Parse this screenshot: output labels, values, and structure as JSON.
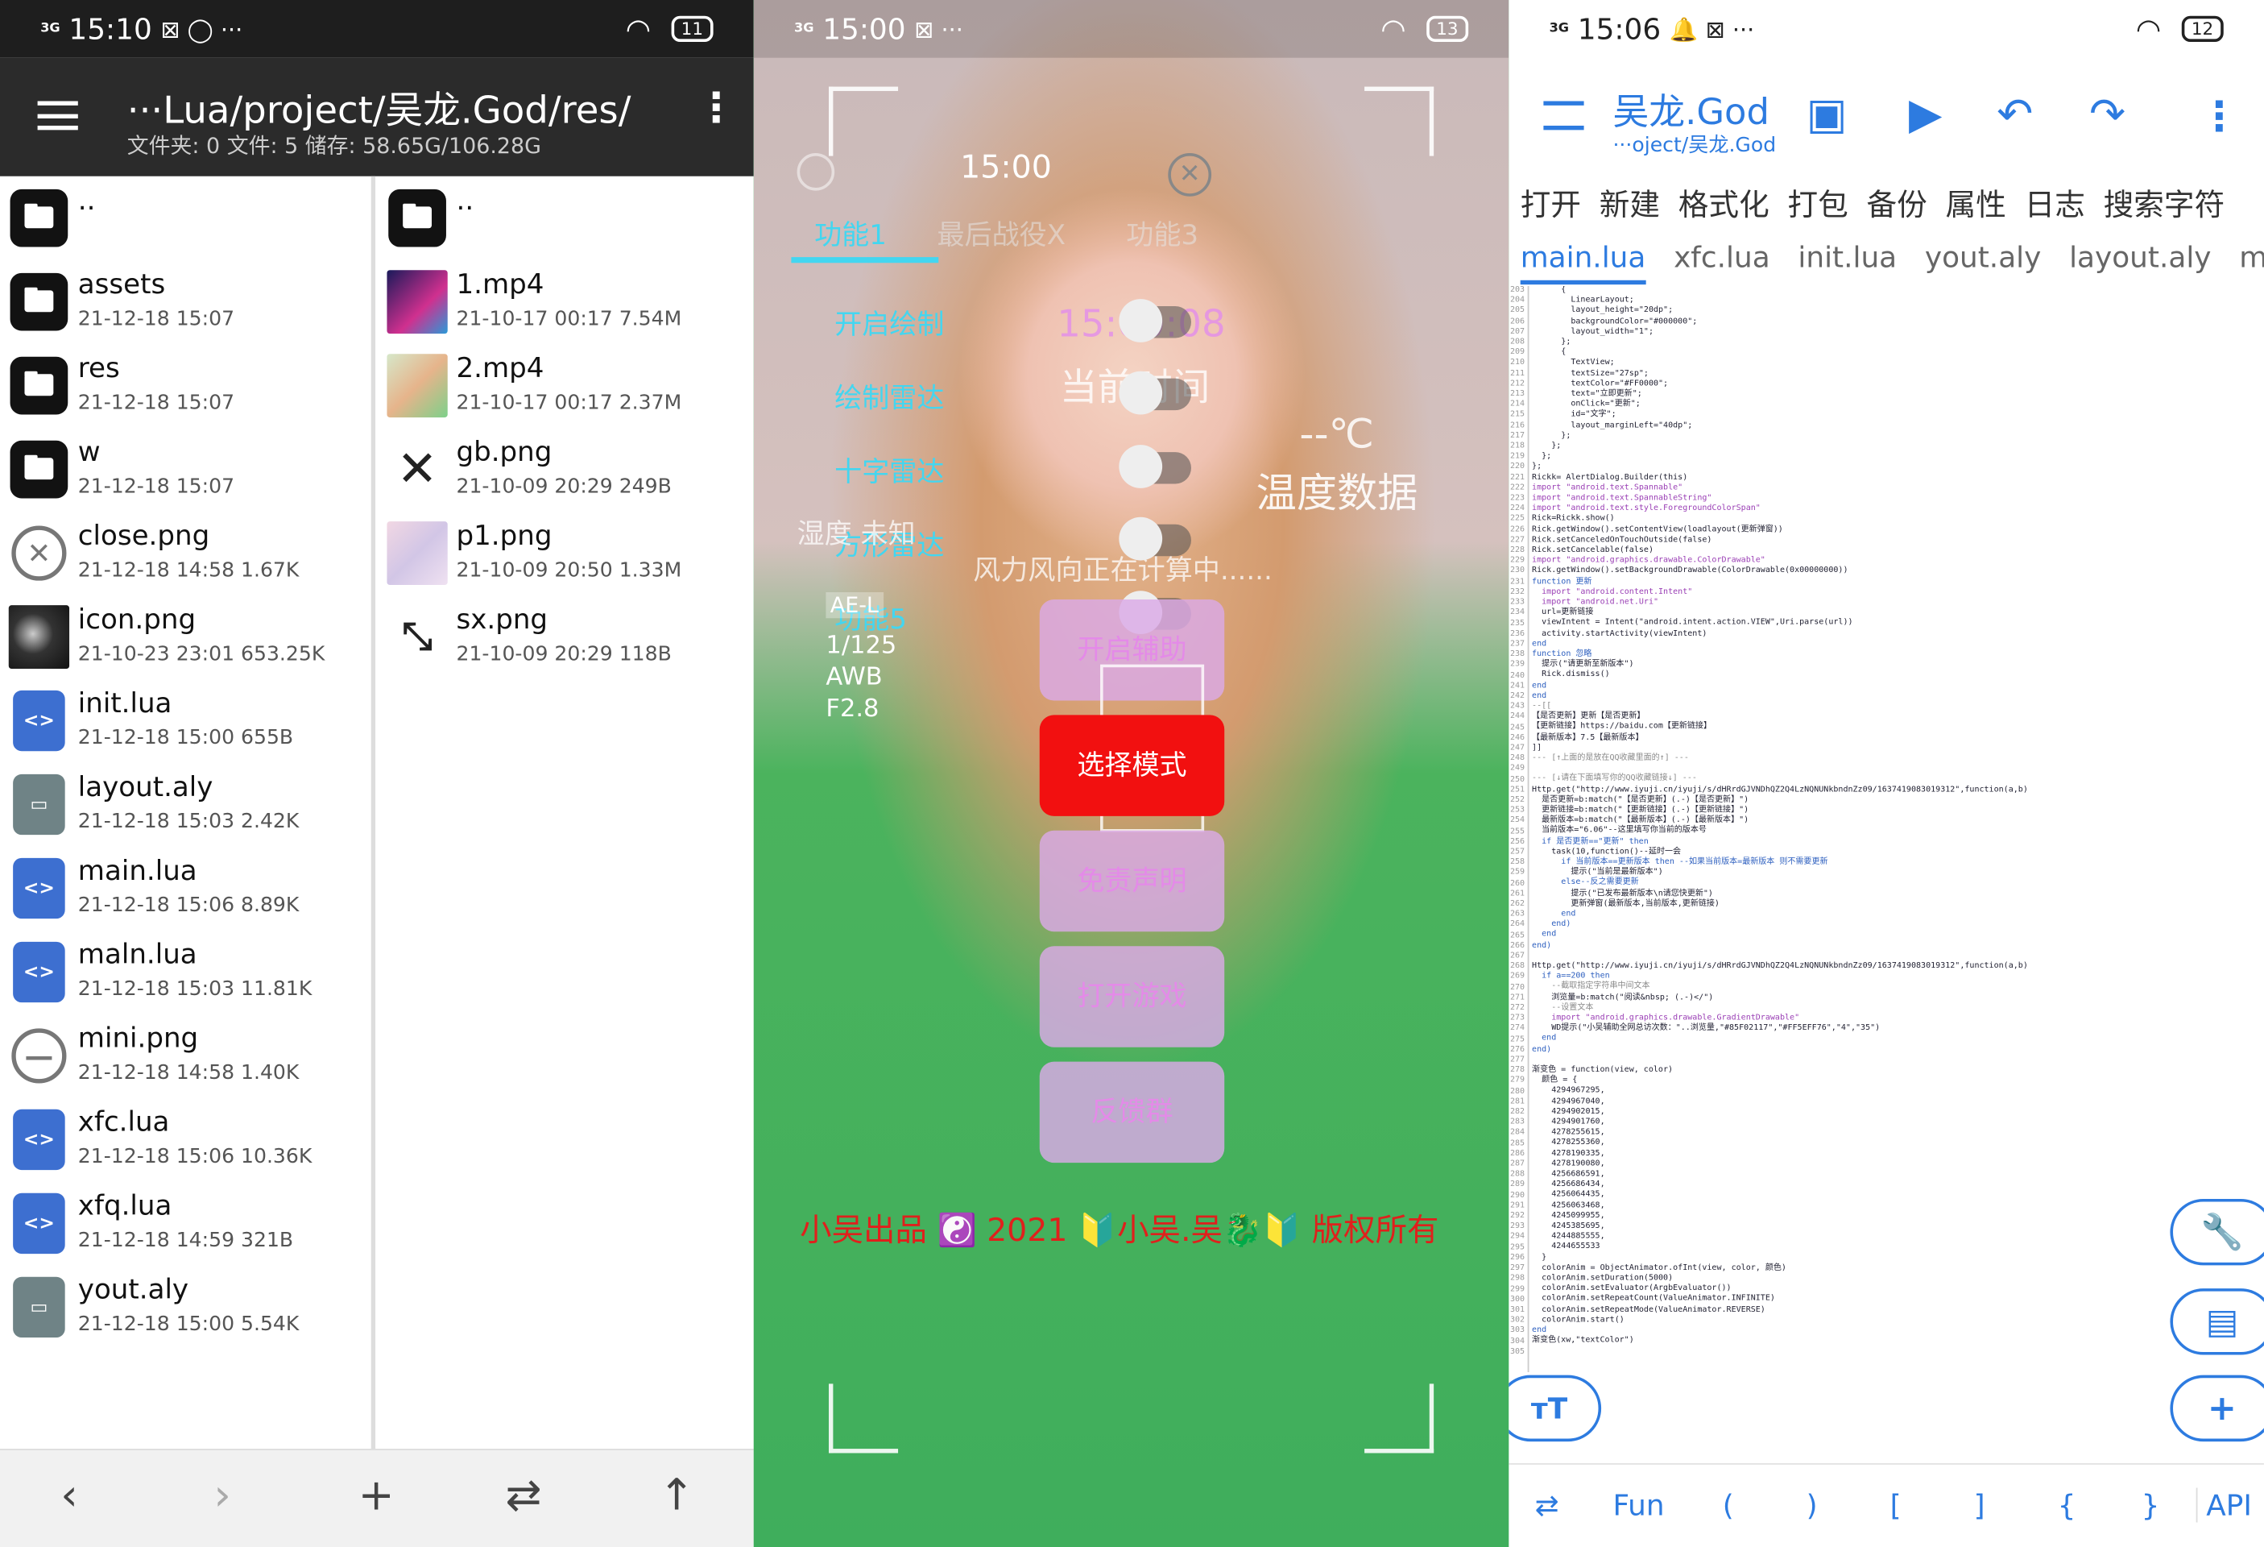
{
  "panel1": {
    "status": {
      "signal": "3G",
      "time": "15:10",
      "icons": "⊠ ◯ ···",
      "battery": "11"
    },
    "toolbar": {
      "path": "···Lua/project/吴龙.God/res/",
      "info": "文件夹: 0  文件: 5  储存: 58.65G/106.28G"
    },
    "left_list": [
      {
        "name": "..",
        "meta": "",
        "icon": "folder-icon"
      },
      {
        "name": "assets",
        "meta": "21-12-18 15:07",
        "icon": "folder-icon"
      },
      {
        "name": "res",
        "meta": "21-12-18 15:07",
        "icon": "folder-icon"
      },
      {
        "name": "w",
        "meta": "21-12-18 15:07",
        "icon": "folder-icon"
      },
      {
        "name": "close.png",
        "meta": "21-12-18 14:58  1.67K",
        "icon": "close-circle-icon"
      },
      {
        "name": "icon.png",
        "meta": "21-10-23 23:01  653.25K",
        "icon": "image-thumbnail"
      },
      {
        "name": "init.lua",
        "meta": "21-12-18 15:00  655B",
        "icon": "code-file-icon"
      },
      {
        "name": "layout.aly",
        "meta": "21-12-18 15:03  2.42K",
        "icon": "file-icon"
      },
      {
        "name": "main.lua",
        "meta": "21-12-18 15:06  8.89K",
        "icon": "code-file-icon"
      },
      {
        "name": "maln.lua",
        "meta": "21-12-18 15:03  11.81K",
        "icon": "code-file-icon"
      },
      {
        "name": "mini.png",
        "meta": "21-12-18 14:58  1.40K",
        "icon": "minus-circle-icon"
      },
      {
        "name": "xfc.lua",
        "meta": "21-12-18 15:06  10.36K",
        "icon": "code-file-icon"
      },
      {
        "name": "xfq.lua",
        "meta": "21-12-18 14:59  321B",
        "icon": "code-file-icon"
      },
      {
        "name": "yout.aly",
        "meta": "21-12-18 15:00  5.54K",
        "icon": "file-icon"
      }
    ],
    "right_list": [
      {
        "name": "..",
        "meta": "",
        "icon": "folder-icon"
      },
      {
        "name": "1.mp4",
        "meta": "21-10-17 00:17  7.54M",
        "icon": "video-thumbnail"
      },
      {
        "name": "2.mp4",
        "meta": "21-10-17 00:17  2.37M",
        "icon": "video-thumbnail"
      },
      {
        "name": "gb.png",
        "meta": "21-10-09 20:29  249B",
        "icon": "x-icon"
      },
      {
        "name": "p1.png",
        "meta": "21-10-09 20:50  1.33M",
        "icon": "image-thumbnail"
      },
      {
        "name": "sx.png",
        "meta": "21-10-09 20:29  118B",
        "icon": "shrink-icon"
      }
    ],
    "bottom_nav": {
      "back": "‹",
      "forward": "›",
      "add": "+",
      "swap": "⇄",
      "up": "↑"
    }
  },
  "panel2": {
    "status": {
      "signal": "3G",
      "time": "15:00",
      "icons": "⊠ ···",
      "battery": "13"
    },
    "clock": "15:00",
    "tabs": [
      "功能1",
      "最后战役X",
      "功能3"
    ],
    "left_menu": [
      "开启绘制",
      "绘制雷达",
      "十字雷达",
      "方形雷达",
      "功能5"
    ],
    "time_value": "15:00:08",
    "time_label": "当前时间",
    "temp_value": "--℃",
    "temp_label": "温度数据",
    "humidity_label": "湿度 未知",
    "wind_text": "风力风向正在计算中......",
    "camera_info": [
      "AE-L",
      "1/125",
      "AWB",
      "F2.8"
    ],
    "buttons": [
      "开启辅助",
      "选择模式",
      "免责声明",
      "打开游戏",
      "反馈群"
    ],
    "copyright": "小吴出品 ☯️ 2021 🔰小吴.吴🐉🔰 版权所有",
    "colors": {
      "accent": "#43d6f0",
      "select": "#f21010",
      "copyright": "#e0201c"
    }
  },
  "panel3": {
    "status": {
      "signal": "3G",
      "time": "15:06",
      "icons": "🔔 ⊠ ···",
      "battery": "12"
    },
    "title": "吴龙.God",
    "subtitle": "···oject/吴龙.God",
    "menu": [
      "打开",
      "新建",
      "格式化",
      "打包",
      "备份",
      "属性",
      "日志",
      "搜索字符"
    ],
    "tabs": [
      "main.lua",
      "xfc.lua",
      "init.lua",
      "yout.aly",
      "layout.aly",
      "maln.lua"
    ],
    "active_tab": "main.lua",
    "code_lines": [
      "      {",
      "        LinearLayout;",
      "        layout_height=\"20dp\";",
      "        backgroundColor=\"#000000\";",
      "        layout_width=\"1\";",
      "      };",
      "      {",
      "        TextView;",
      "        textSize=\"27sp\";",
      "        textColor=\"#FF0000\";",
      "        text=\"立即更新\";",
      "        onClick=\"更新\";",
      "        id=\"文字\";",
      "        layout_marginLeft=\"40dp\";",
      "      };",
      "    };",
      "  };",
      "};",
      "Rickk= AlertDialog.Builder(this)",
      "import \"android.text.Spannable\"",
      "import \"android.text.SpannableString\"",
      "import \"android.text.style.ForegroundColorSpan\"",
      "Rick=Rickk.show()",
      "Rick.getWindow().setContentView(loadlayout(更新弹窗))",
      "Rick.setCanceledOnTouchOutside(false)",
      "Rick.setCancelable(false)",
      "import \"android.graphics.drawable.ColorDrawable\"",
      "Rick.getWindow().setBackgroundDrawable(ColorDrawable(0x00000000))",
      "function 更新",
      "  import \"android.content.Intent\"",
      "  import \"android.net.Uri\"",
      "  url=更新链接",
      "  viewIntent = Intent(\"android.intent.action.VIEW\",Uri.parse(url))",
      "  activity.startActivity(viewIntent)",
      "end",
      "function 忽略",
      "  提示(\"请更新至新版本\")",
      "  Rick.dismiss()",
      "end",
      "end",
      "--[[",
      "【是否更新】更新【是否更新】",
      "【更新链接】https://baidu.com【更新链接】",
      "【最新版本】7.5【最新版本】",
      "]]",
      "--- [↑上面的是放在QQ收藏里面的↑] ---",
      "",
      "--- [↓请在下面填写你的QQ收藏链接↓] ---",
      "Http.get(\"http://www.iyuji.cn/iyuji/s/dHRrdGJVNDhQZ2Q4LzNQNUNkbndnZz09/1637419083019312\",function(a,b)",
      "  是否更新=b:match(\"【是否更新】(.-)【是否更新】\")",
      "  更新链接=b:match(\"【更新链接】(.-)【更新链接】\")",
      "  最新版本=b:match(\"【最新版本】(.-)【最新版本】\")",
      "  当前版本=\"6.06\"--这里填写你当前的版本号",
      "  if 是否更新==\"更新\" then",
      "    task(10,function()--延时一会",
      "      if 当前版本==更新版本 then --如果当前版本=最新版本 则不需要更新",
      "        提示(\"当前是最新版本\")",
      "      else--反之需要更新",
      "        提示(\"已发布最新版本\\n请您快更新\")",
      "        更新弹窗(最新版本,当前版本,更新链接)",
      "      end",
      "    end)",
      "  end",
      "end)",
      "",
      "Http.get(\"http://www.iyuji.cn/iyuji/s/dHRrdGJVNDhQZ2Q4LzNQNUNkbndnZz09/1637419083019312\",function(a,b)",
      "  if a==200 then",
      "    --截取指定字符串中间文本",
      "    浏览量=b:match(\"阅读&nbsp; (.-)</\")",
      "    --设置文本",
      "    import \"android.graphics.drawable.GradientDrawable\"",
      "    WD提示(\"小吴辅助全网总访次数：\"..浏览量,\"#85F02117\",\"#FF5EFF76\",\"4\",\"35\")",
      "  end",
      "end)",
      "",
      "渐变色 = function(view, color)",
      "  颜色 = {",
      "    4294967295,",
      "    4294967040,",
      "    4294902015,",
      "    4294901760,",
      "    4278255615,",
      "    4278255360,",
      "    4278190335,",
      "    4278190080,",
      "    4256686591,",
      "    4256686434,",
      "    4256064435,",
      "    4256063468,",
      "    4245099955,",
      "    4245385695,",
      "    4244885555,",
      "    4244655533",
      "  }",
      "  colorAnim = ObjectAnimator.ofInt(view, color, 颜色)",
      "  colorAnim.setDuration(5000)",
      "  colorAnim.setEvaluator(ArgbEvaluator())",
      "  colorAnim.setRepeatCount(ValueAnimator.INFINITE)",
      "  colorAnim.setRepeatMode(ValueAnimator.REVERSE)",
      "  colorAnim.start()",
      "end",
      "渐变色(xw,\"textColor\")",
      ""
    ],
    "keys": [
      "⇄",
      "Fun",
      "(",
      ")",
      "[",
      "]",
      "{",
      "}",
      "API"
    ],
    "colors": {
      "accent": "#2d7be0"
    }
  }
}
